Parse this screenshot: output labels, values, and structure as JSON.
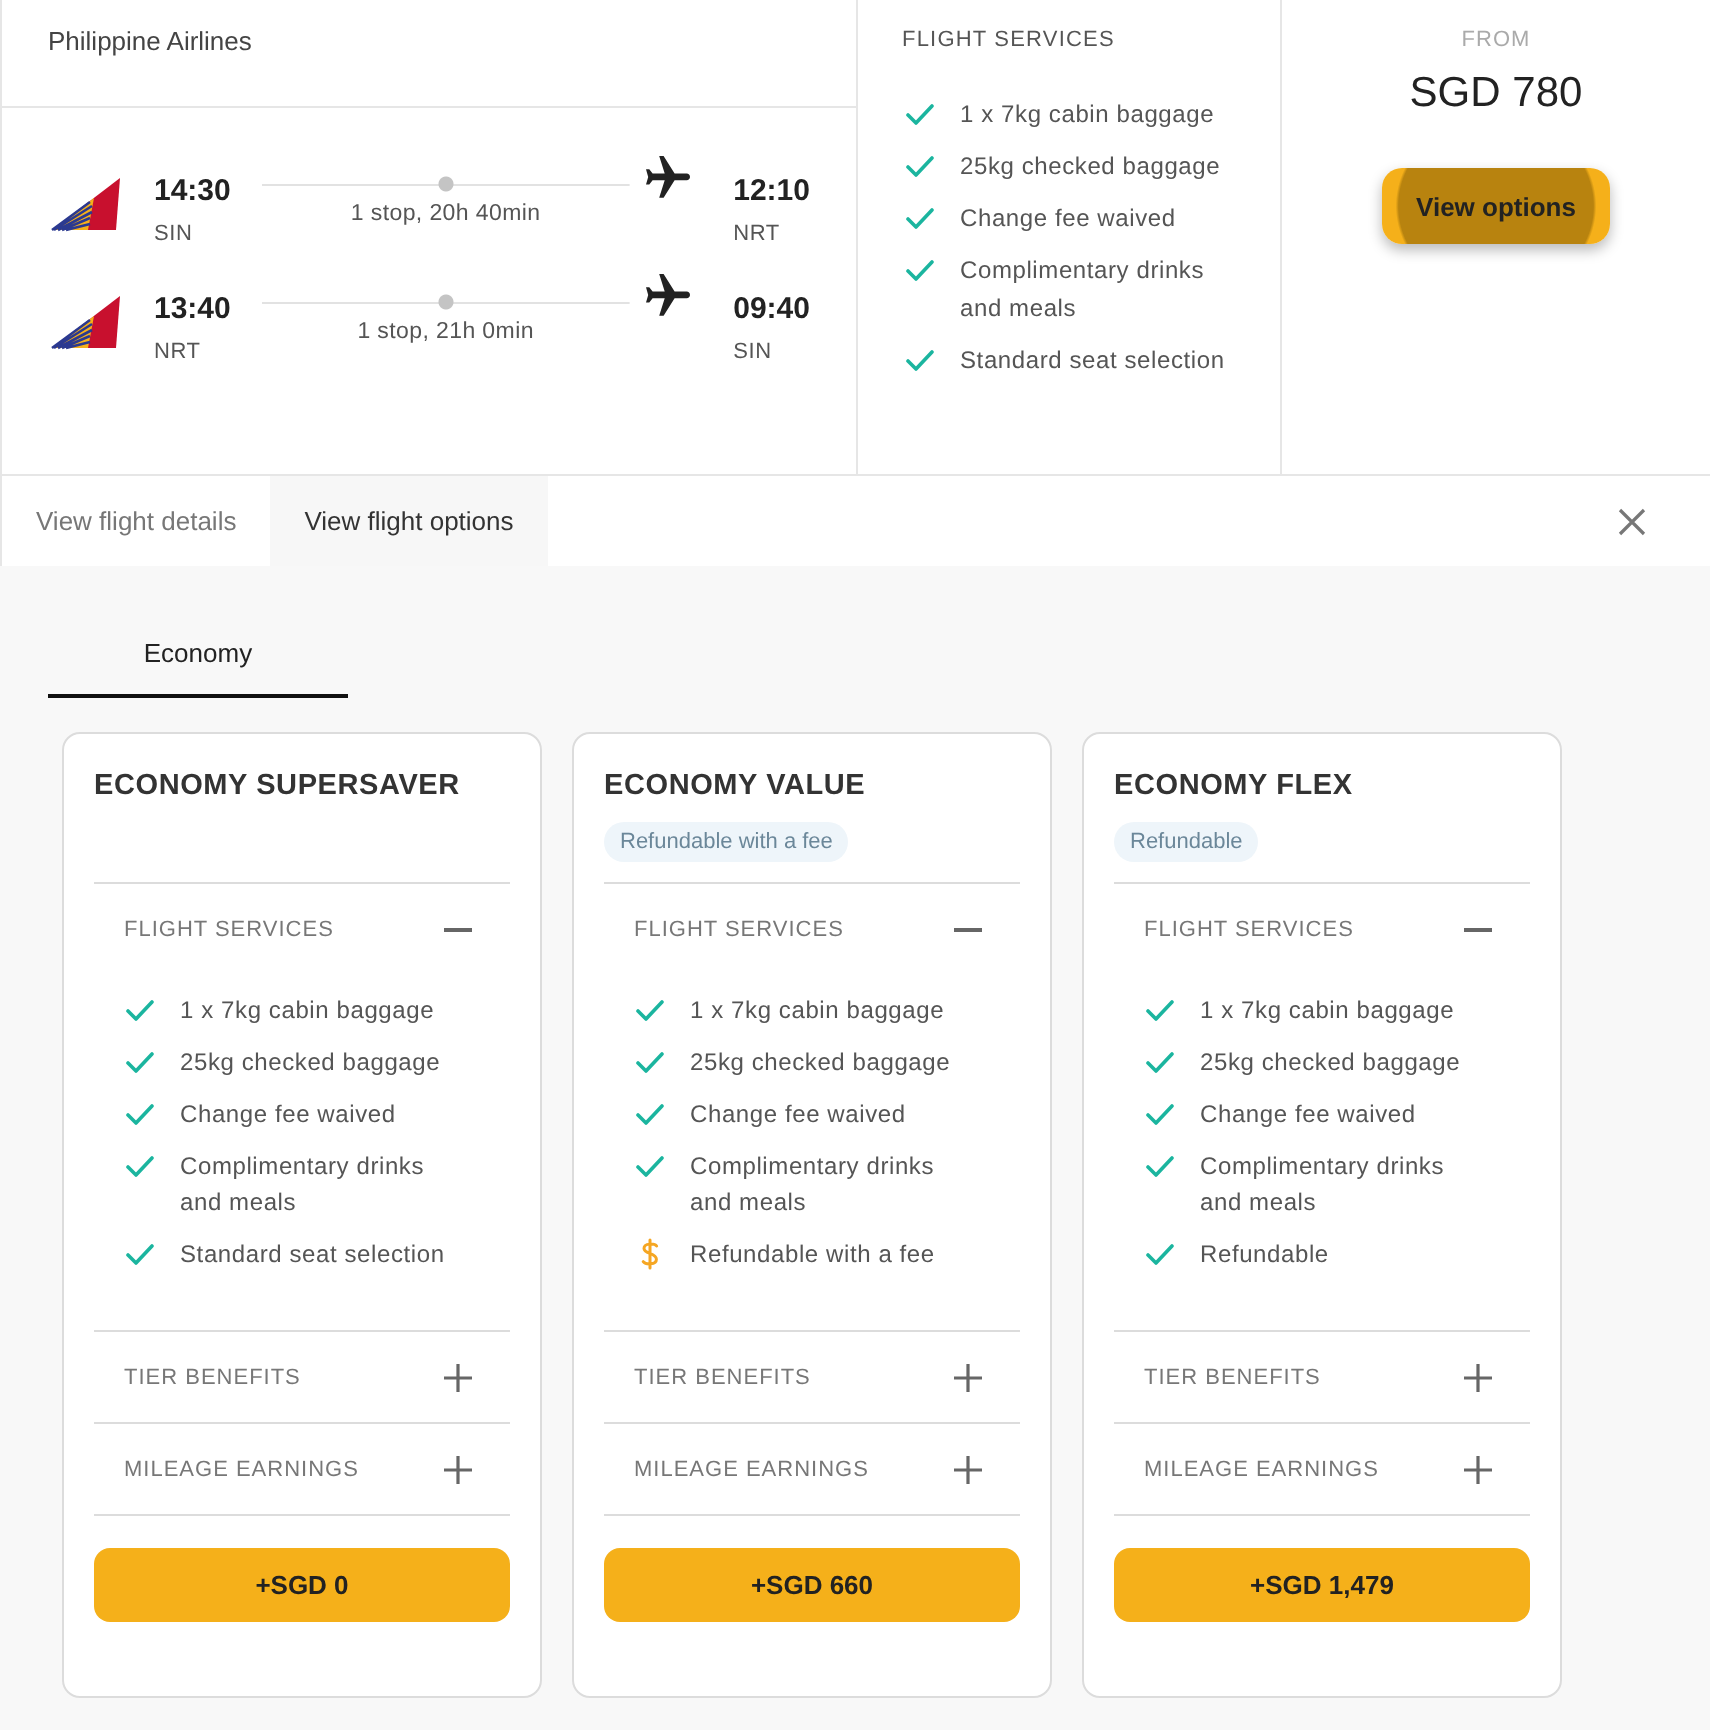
{
  "itinerary": {
    "airline": "Philippine Airlines",
    "legs": [
      {
        "depart_time": "14:30",
        "depart_airport": "SIN",
        "summary": "1 stop, 20h 40min",
        "arrive_time": "12:10",
        "arrive_airport": "NRT"
      },
      {
        "depart_time": "13:40",
        "depart_airport": "NRT",
        "summary": "1 stop, 21h 0min",
        "arrive_time": "09:40",
        "arrive_airport": "SIN"
      }
    ]
  },
  "flight_services": {
    "title": "FLIGHT SERVICES",
    "items": [
      {
        "text": "1 x 7kg cabin baggage",
        "kind": "included"
      },
      {
        "text": "25kg checked baggage",
        "kind": "included"
      },
      {
        "text": "Change fee waived",
        "kind": "included"
      },
      {
        "text": "Complimentary drinks and meals",
        "kind": "included"
      },
      {
        "text": "Standard seat selection",
        "kind": "included"
      }
    ]
  },
  "price": {
    "label": "FROM",
    "amount": "SGD 780",
    "button": "View options"
  },
  "tabs": [
    {
      "label": "View flight details",
      "selected": false
    },
    {
      "label": "View flight options",
      "selected": true
    }
  ],
  "cabin_tabs": [
    {
      "label": "Economy",
      "selected": true
    }
  ],
  "fares": [
    {
      "name": "ECONOMY SUPERSAVER",
      "sections": [
        {
          "title": "FLIGHT SERVICES",
          "expanded": true,
          "items": [
            {
              "text": "1 x 7kg cabin baggage",
              "kind": "included"
            },
            {
              "text": "25kg checked baggage",
              "kind": "included"
            },
            {
              "text": "Change fee waived",
              "kind": "included"
            },
            {
              "text": "Complimentary drinks and meals",
              "kind": "included"
            },
            {
              "text": "Standard seat selection",
              "kind": "included"
            }
          ]
        },
        {
          "title": "TIER BENEFITS",
          "expanded": false
        },
        {
          "title": "MILEAGE EARNINGS",
          "expanded": false
        }
      ],
      "price_button": "+SGD 0"
    },
    {
      "name": "ECONOMY VALUE",
      "badge": "Refundable with a fee",
      "sections": [
        {
          "title": "FLIGHT SERVICES",
          "expanded": true,
          "items": [
            {
              "text": "1 x 7kg cabin baggage",
              "kind": "included"
            },
            {
              "text": "25kg checked baggage",
              "kind": "included"
            },
            {
              "text": "Change fee waived",
              "kind": "included"
            },
            {
              "text": "Complimentary drinks and meals",
              "kind": "included"
            },
            {
              "text": "Refundable with a fee",
              "kind": "fee"
            }
          ]
        },
        {
          "title": "TIER BENEFITS",
          "expanded": false
        },
        {
          "title": "MILEAGE EARNINGS",
          "expanded": false
        }
      ],
      "price_button": "+SGD 660"
    },
    {
      "name": "ECONOMY FLEX",
      "badge": "Refundable",
      "sections": [
        {
          "title": "FLIGHT SERVICES",
          "expanded": true,
          "items": [
            {
              "text": "1 x 7kg cabin baggage",
              "kind": "included"
            },
            {
              "text": "25kg checked baggage",
              "kind": "included"
            },
            {
              "text": "Change fee waived",
              "kind": "included"
            },
            {
              "text": "Complimentary drinks and meals",
              "kind": "included"
            },
            {
              "text": "Refundable",
              "kind": "included"
            }
          ]
        },
        {
          "title": "TIER BENEFITS",
          "expanded": false
        },
        {
          "title": "MILEAGE EARNINGS",
          "expanded": false
        }
      ],
      "price_button": "+SGD 1,479"
    }
  ]
}
